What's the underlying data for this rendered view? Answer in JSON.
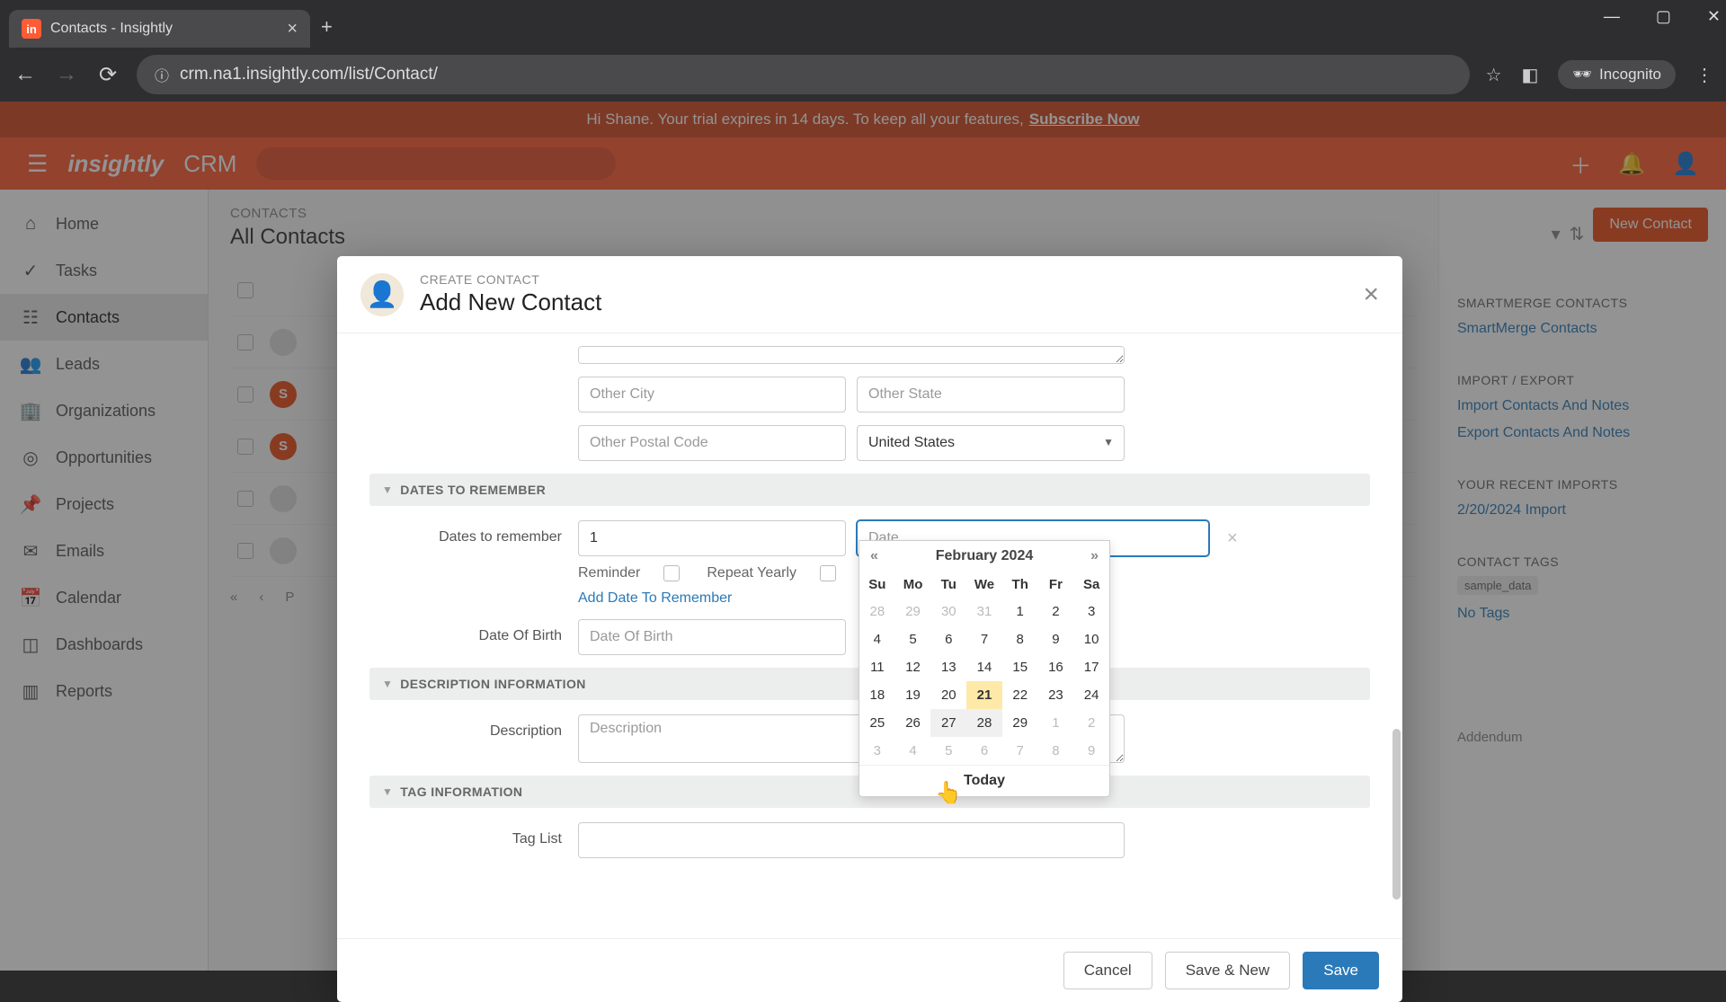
{
  "browser": {
    "tab_title": "Contacts - Insightly",
    "url": "crm.na1.insightly.com/list/Contact/",
    "incognito": "Incognito"
  },
  "banner": {
    "text_prefix": "Hi Shane. Your trial expires in 14 days. To keep all your features, ",
    "link": "Subscribe Now"
  },
  "header": {
    "logo": "insightly",
    "app": "CRM"
  },
  "leftnav": {
    "items": [
      {
        "label": "Home",
        "icon": "⌂"
      },
      {
        "label": "Tasks",
        "icon": "✓"
      },
      {
        "label": "Contacts",
        "icon": "☷"
      },
      {
        "label": "Leads",
        "icon": "👥"
      },
      {
        "label": "Organizations",
        "icon": "🏢"
      },
      {
        "label": "Opportunities",
        "icon": "◎"
      },
      {
        "label": "Projects",
        "icon": "📌"
      },
      {
        "label": "Emails",
        "icon": "✉"
      },
      {
        "label": "Calendar",
        "icon": "📅"
      },
      {
        "label": "Dashboards",
        "icon": "◫"
      },
      {
        "label": "Reports",
        "icon": "▥"
      }
    ]
  },
  "list": {
    "eyebrow": "CONTACTS",
    "title": "All Contacts",
    "page_letter": "P"
  },
  "rightpanel": {
    "new_contact": "New Contact",
    "smartmerge_h": "SMARTMERGE CONTACTS",
    "smartmerge_link": "SmartMerge Contacts",
    "import_h": "IMPORT / EXPORT",
    "import_link": "Import Contacts And Notes",
    "export_link": "Export Contacts And Notes",
    "recent_h": "YOUR RECENT IMPORTS",
    "recent_link": "2/20/2024 Import",
    "tags_h": "CONTACT TAGS",
    "sample_tag": "sample_data",
    "no_tags": "No Tags",
    "addendum": "Addendum"
  },
  "modal": {
    "eyebrow": "CREATE CONTACT",
    "title": "Add New Contact",
    "other_city_ph": "Other City",
    "other_state_ph": "Other State",
    "other_postal_ph": "Other Postal Code",
    "country": "United States",
    "section_dates": "DATES TO REMEMBER",
    "dates_label": "Dates to remember",
    "reminder_val": "1",
    "date_ph": "Date",
    "reminder_lbl": "Reminder",
    "repeat_lbl": "Repeat Yearly",
    "add_date": "Add Date To Remember",
    "dob_label": "Date Of Birth",
    "dob_ph": "Date Of Birth",
    "section_desc": "DESCRIPTION INFORMATION",
    "desc_label": "Description",
    "desc_ph": "Description",
    "section_tag": "TAG INFORMATION",
    "tag_label": "Tag List",
    "cancel": "Cancel",
    "save_new": "Save & New",
    "save": "Save"
  },
  "datepicker": {
    "month": "February 2024",
    "prev": "«",
    "next": "»",
    "dow": [
      "Su",
      "Mo",
      "Tu",
      "We",
      "Th",
      "Fr",
      "Sa"
    ],
    "weeks": [
      [
        {
          "d": "28",
          "m": true
        },
        {
          "d": "29",
          "m": true
        },
        {
          "d": "30",
          "m": true
        },
        {
          "d": "31",
          "m": true
        },
        {
          "d": "1"
        },
        {
          "d": "2"
        },
        {
          "d": "3"
        }
      ],
      [
        {
          "d": "4"
        },
        {
          "d": "5"
        },
        {
          "d": "6"
        },
        {
          "d": "7"
        },
        {
          "d": "8"
        },
        {
          "d": "9"
        },
        {
          "d": "10"
        }
      ],
      [
        {
          "d": "11"
        },
        {
          "d": "12"
        },
        {
          "d": "13"
        },
        {
          "d": "14"
        },
        {
          "d": "15"
        },
        {
          "d": "16"
        },
        {
          "d": "17"
        }
      ],
      [
        {
          "d": "18"
        },
        {
          "d": "19"
        },
        {
          "d": "20"
        },
        {
          "d": "21",
          "today": true
        },
        {
          "d": "22"
        },
        {
          "d": "23"
        },
        {
          "d": "24"
        }
      ],
      [
        {
          "d": "25"
        },
        {
          "d": "26"
        },
        {
          "d": "27",
          "hover": true
        },
        {
          "d": "28",
          "hover": true
        },
        {
          "d": "29"
        },
        {
          "d": "1",
          "m": true
        },
        {
          "d": "2",
          "m": true
        }
      ],
      [
        {
          "d": "3",
          "m": true
        },
        {
          "d": "4",
          "m": true
        },
        {
          "d": "5",
          "m": true
        },
        {
          "d": "6",
          "m": true
        },
        {
          "d": "7",
          "m": true
        },
        {
          "d": "8",
          "m": true
        },
        {
          "d": "9",
          "m": true
        }
      ]
    ],
    "today": "Today"
  }
}
